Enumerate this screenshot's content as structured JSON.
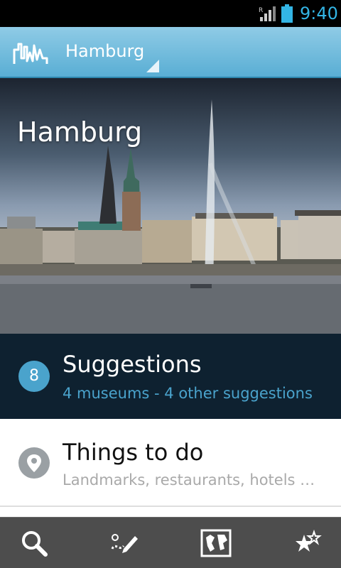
{
  "status_bar": {
    "time": "9:40",
    "signal_icon": "signal-roaming-icon",
    "battery_icon": "battery-icon",
    "accent_color": "#33b5e5"
  },
  "action_bar": {
    "logo_icon": "city-skyline-logo-icon",
    "city_selector": "Hamburg"
  },
  "hero": {
    "title": "Hamburg"
  },
  "suggestions": {
    "count": "8",
    "title": "Suggestions",
    "subtitle": "4 museums - 4 other suggestions"
  },
  "things_to_do": {
    "icon": "location-pin-icon",
    "title": "Things to do",
    "subtitle": "Landmarks, restaurants, hotels …"
  },
  "bottom_nav": {
    "items": [
      {
        "icon": "search-icon"
      },
      {
        "icon": "edit-route-icon"
      },
      {
        "icon": "world-map-icon"
      },
      {
        "icon": "favorites-stars-icon"
      }
    ]
  }
}
